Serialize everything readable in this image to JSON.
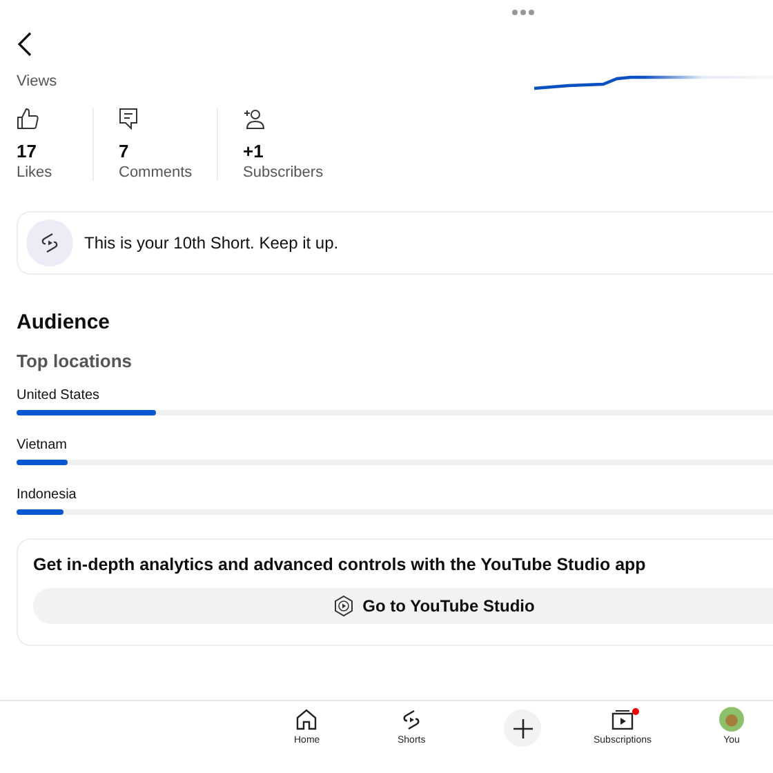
{
  "header": {
    "metric_label": "Views"
  },
  "stats": [
    {
      "kind": "like",
      "value": "17",
      "label": "Likes"
    },
    {
      "kind": "comment",
      "value": "7",
      "label": "Comments"
    },
    {
      "kind": "subscriber",
      "value": "+1",
      "label": "Subscribers"
    }
  ],
  "milestone": {
    "text": "This is your 10th Short. Keep it up."
  },
  "audience": {
    "title": "Audience",
    "subtitle": "Top locations",
    "locations": [
      {
        "name": "United States",
        "level": 0.18
      },
      {
        "name": "Vietnam",
        "level": 0.066
      },
      {
        "name": "Indonesia",
        "level": 0.06
      }
    ]
  },
  "promo": {
    "text": "Get in-depth analytics and advanced controls with the YouTube Studio app",
    "button": "Go to YouTube Studio"
  },
  "nav": [
    {
      "kind": "home",
      "label": "Home",
      "dot": false
    },
    {
      "kind": "shorts",
      "label": "Shorts",
      "dot": false
    },
    {
      "kind": "create"
    },
    {
      "kind": "subscriptions",
      "label": "Subscriptions",
      "dot": true
    },
    {
      "kind": "you",
      "label": "You",
      "dot": false
    }
  ]
}
